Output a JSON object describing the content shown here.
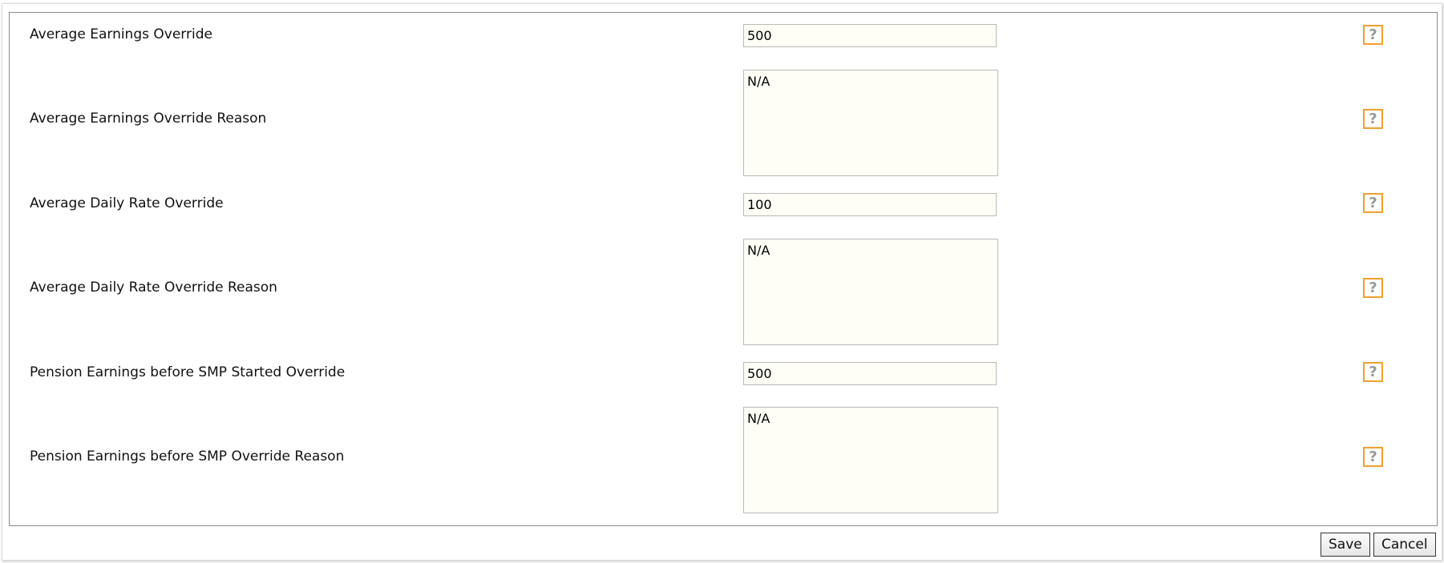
{
  "fields": [
    {
      "label": "Average Earnings Override",
      "value": "500",
      "help_icon": "question-mark-icon"
    },
    {
      "label": "Average Earnings Override Reason",
      "value": "N/A",
      "help_icon": "question-mark-icon"
    },
    {
      "label": "Average Daily Rate Override",
      "value": "100",
      "help_icon": "question-mark-icon"
    },
    {
      "label": "Average Daily Rate Override Reason",
      "value": "N/A",
      "help_icon": "question-mark-icon"
    },
    {
      "label": "Pension Earnings before SMP Started Override",
      "value": "500",
      "help_icon": "question-mark-icon"
    },
    {
      "label": "Pension Earnings before SMP Override Reason",
      "value": "N/A",
      "help_icon": "question-mark-icon"
    }
  ],
  "help_glyph": "?",
  "actions": {
    "save_label": "Save",
    "cancel_label": "Cancel"
  },
  "colors": {
    "help_border": "#f0a030",
    "input_background": "#fefef6"
  }
}
